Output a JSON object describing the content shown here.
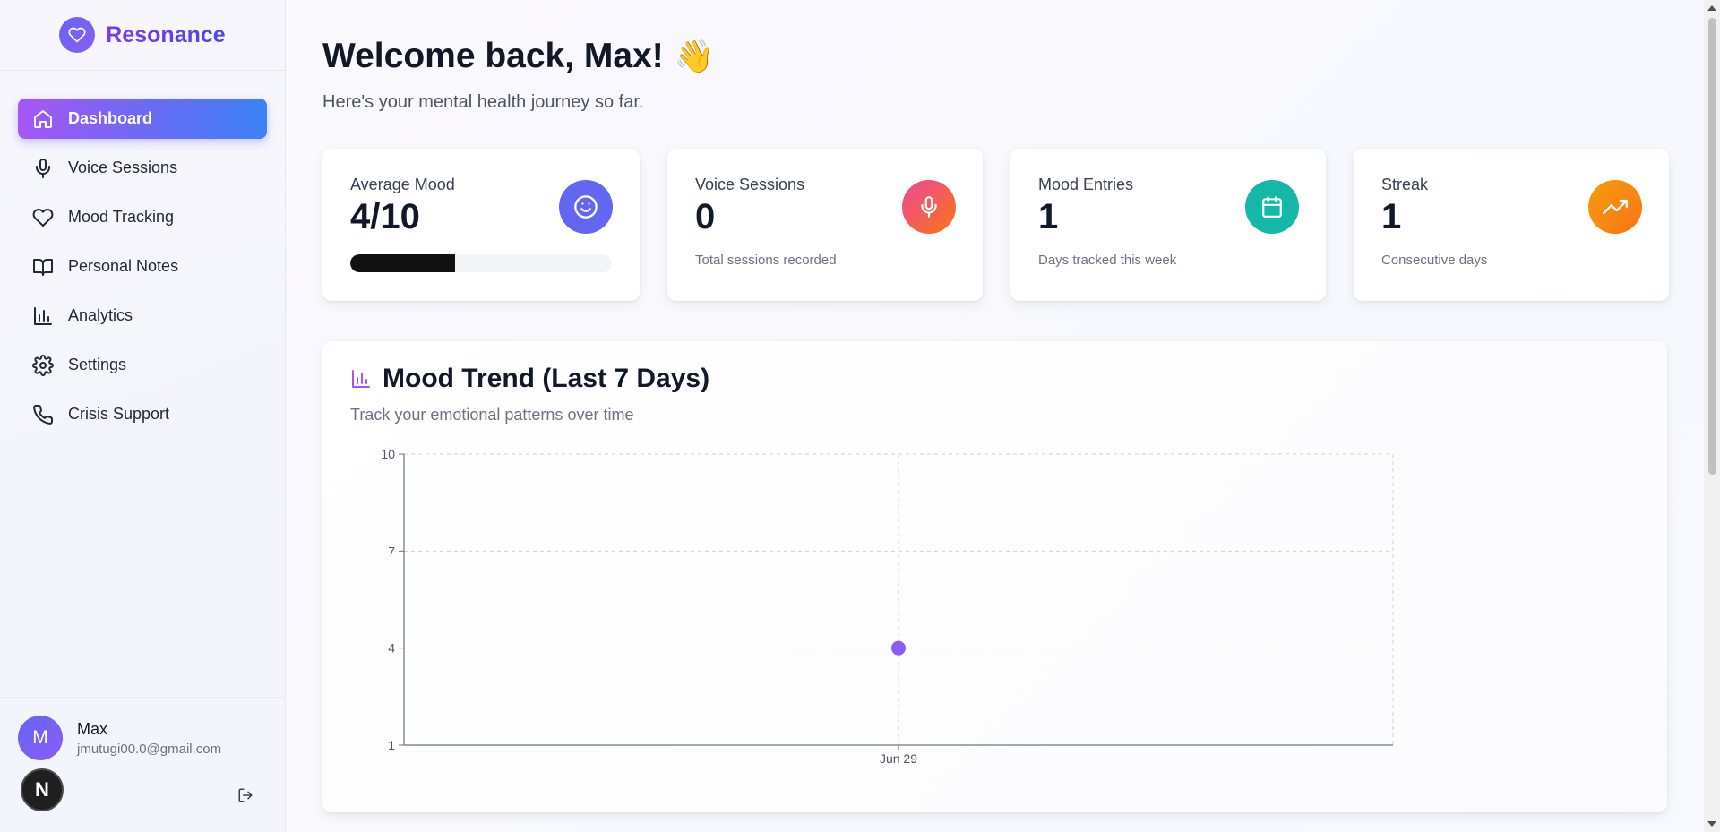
{
  "app": {
    "name": "Resonance"
  },
  "sidebar": {
    "items": [
      {
        "label": "Dashboard",
        "icon": "home-icon",
        "active": true
      },
      {
        "label": "Voice Sessions",
        "icon": "mic-icon",
        "active": false
      },
      {
        "label": "Mood Tracking",
        "icon": "heart-icon",
        "active": false
      },
      {
        "label": "Personal Notes",
        "icon": "book-icon",
        "active": false
      },
      {
        "label": "Analytics",
        "icon": "bar-chart-icon",
        "active": false
      },
      {
        "label": "Settings",
        "icon": "gear-icon",
        "active": false
      },
      {
        "label": "Crisis Support",
        "icon": "phone-icon",
        "active": false
      }
    ],
    "user": {
      "initial": "M",
      "name": "Max",
      "email": "jmutugi00.0@gmail.com"
    },
    "next_badge": "N"
  },
  "header": {
    "welcome": "Welcome back, Max!",
    "emoji": "👋",
    "subtitle": "Here's your mental health journey so far."
  },
  "stats": {
    "mood": {
      "label": "Average Mood",
      "value": "4/10",
      "progress": 0.4,
      "icon": "smile-icon",
      "color": "#6366f1"
    },
    "voice": {
      "label": "Voice Sessions",
      "value": "0",
      "caption": "Total sessions recorded",
      "icon": "mic-icon",
      "color_from": "#ec4899",
      "color_to": "#f97316"
    },
    "entries": {
      "label": "Mood Entries",
      "value": "1",
      "caption": "Days tracked this week",
      "icon": "calendar-icon",
      "color": "#14b8a6"
    },
    "streak": {
      "label": "Streak",
      "value": "1",
      "caption": "Consecutive days",
      "icon": "trending-up-icon",
      "color_from": "#f59e0b",
      "color_to": "#f97316"
    }
  },
  "chart_section": {
    "title": "Mood Trend (Last 7 Days)",
    "subtitle": "Track your emotional patterns over time"
  },
  "chart_data": {
    "type": "scatter",
    "categories": [
      "Jun 29"
    ],
    "series": [
      {
        "values": [
          4
        ],
        "color": "#8b5cf6"
      }
    ],
    "ylim": [
      1,
      10
    ],
    "yticks": [
      1,
      4,
      7,
      10
    ],
    "grid": true,
    "xlabel": "",
    "ylabel": ""
  }
}
